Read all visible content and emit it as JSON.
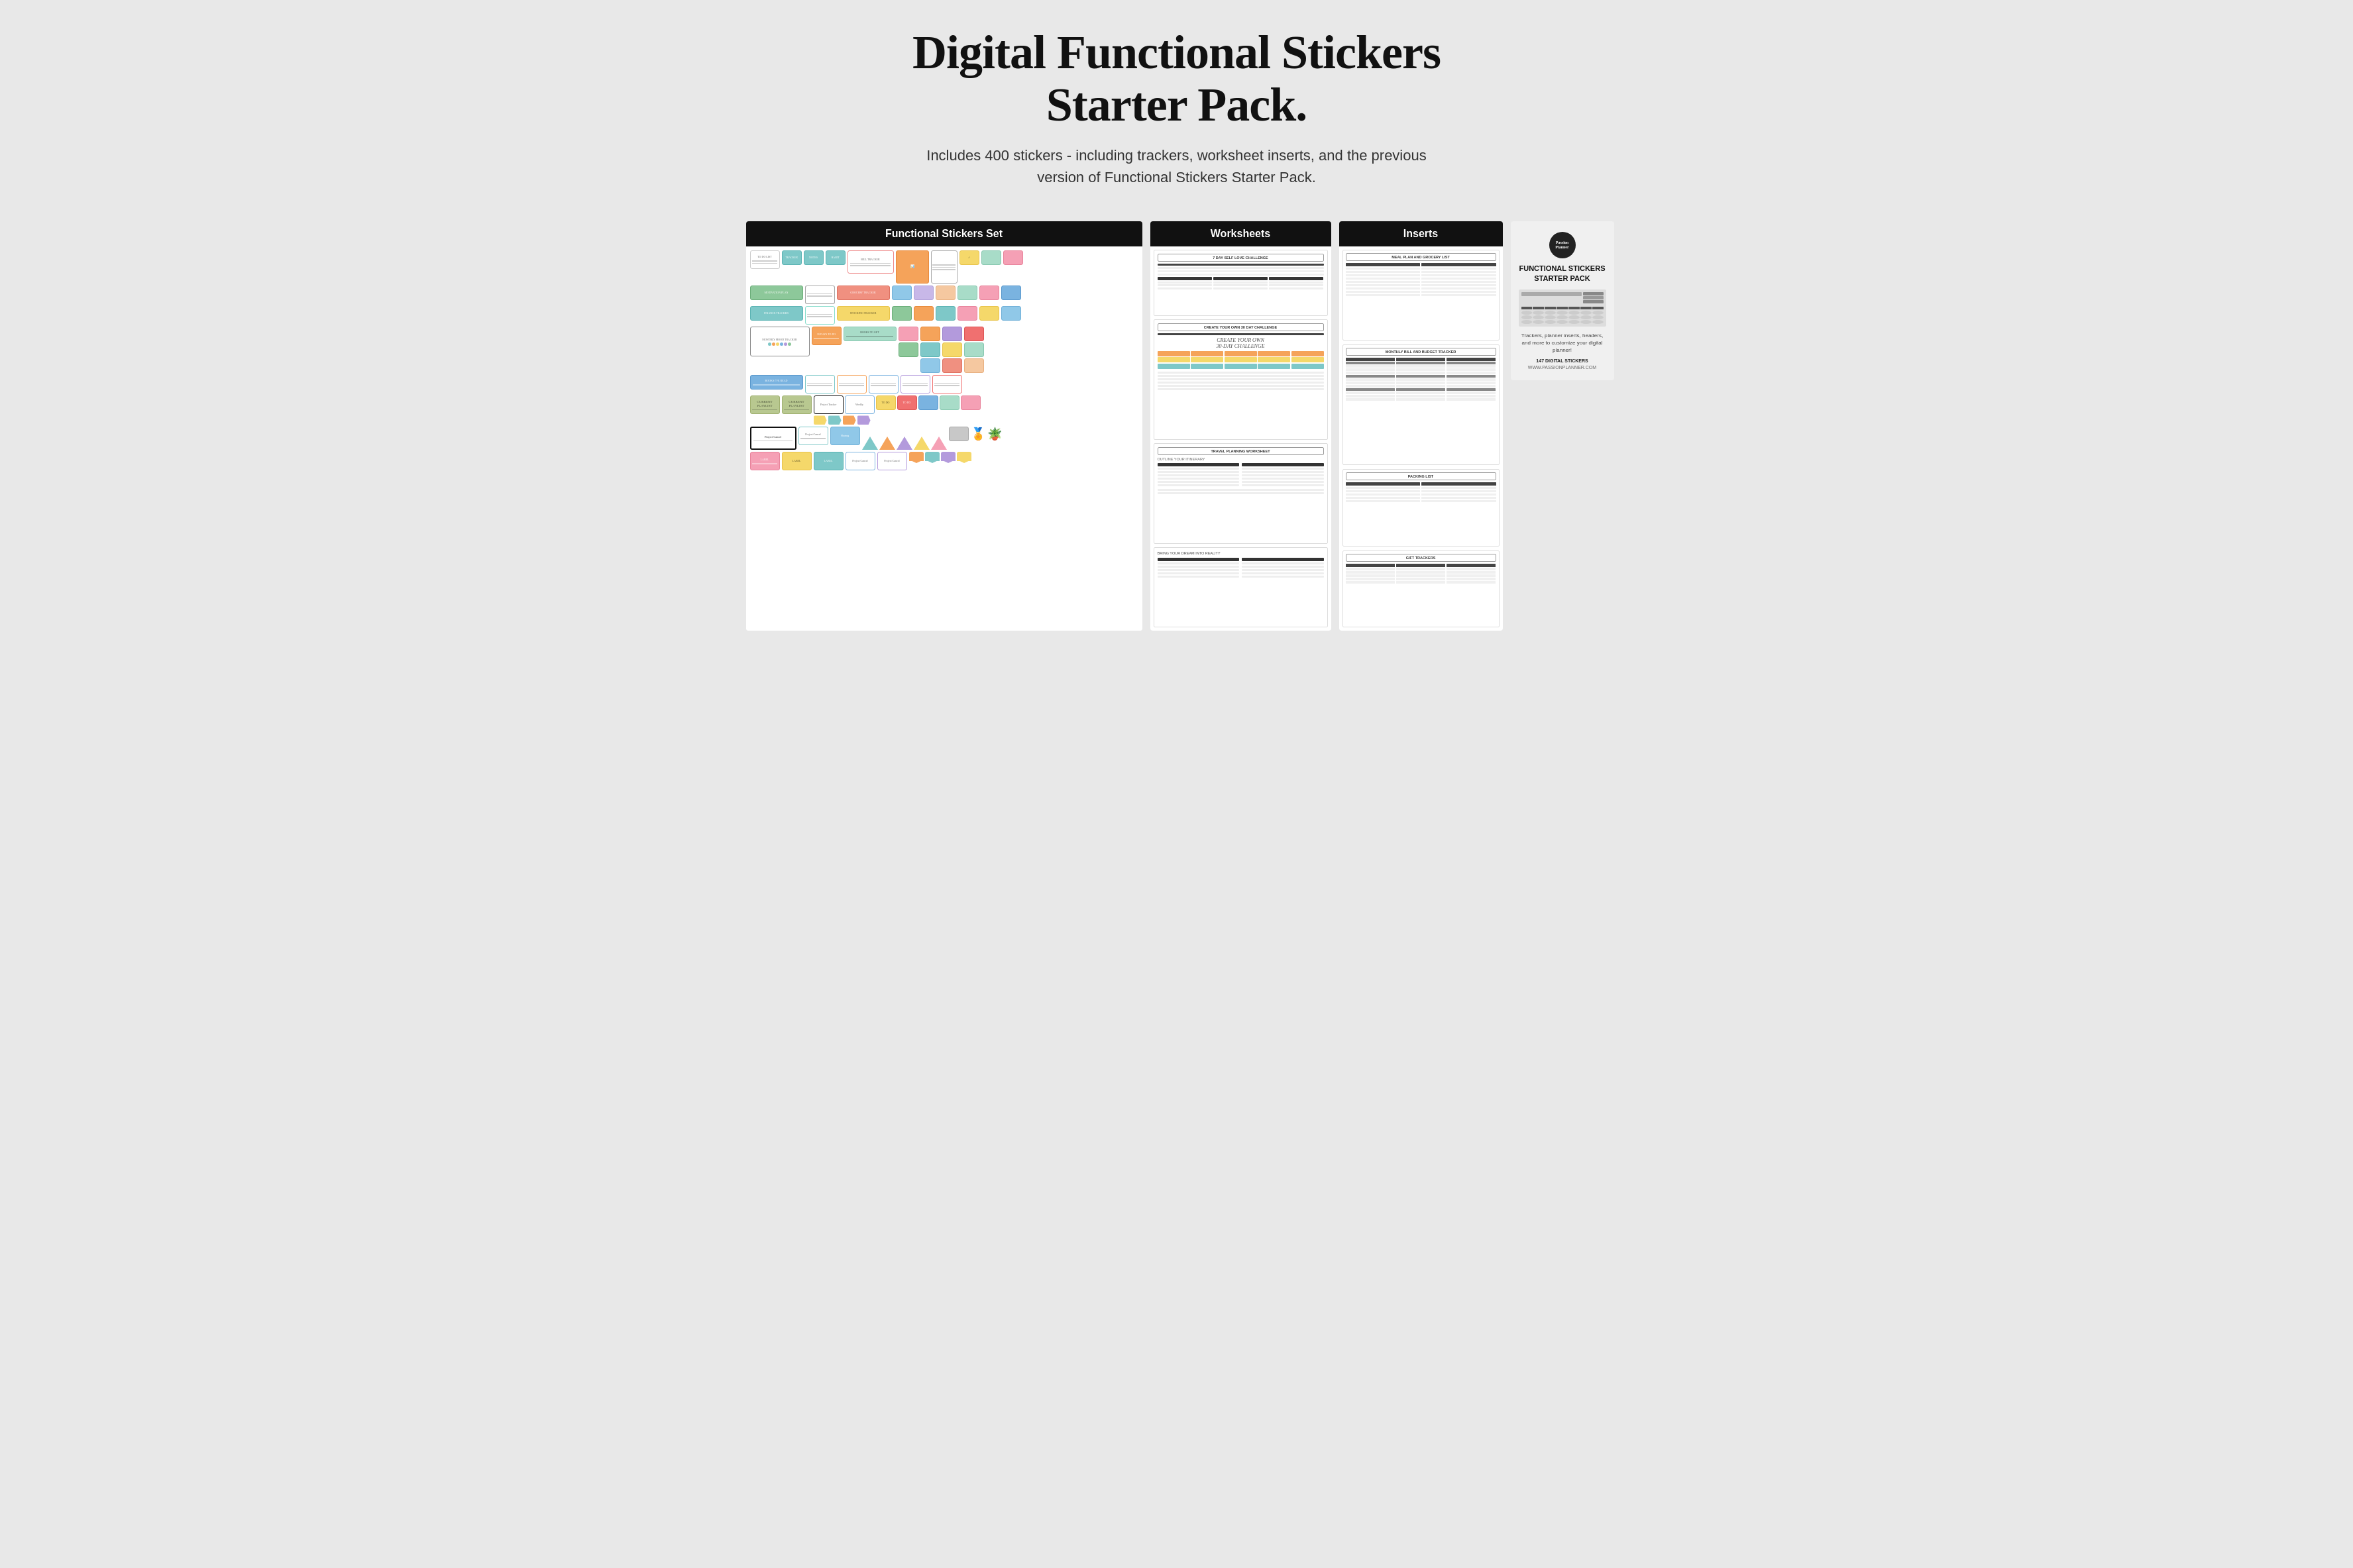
{
  "page": {
    "background_color": "#e8e8e8"
  },
  "header": {
    "title_line1": "Digital Functional Stickers",
    "title_line2": "Starter Pack.",
    "subtitle": "Includes 400 stickers - including trackers, worksheet inserts, and the previous version of Functional Stickers Starter Pack."
  },
  "panels": {
    "stickers": {
      "header": "Functional Stickers Set"
    },
    "worksheets": {
      "header": "Worksheets",
      "items": [
        "7 DAY SELF LOVE CHALLENGE",
        "CREATE YOUR OWN 30 DAY CHALLENGE",
        "TRAVEL PLANNING WORKSHEET",
        "BRING YOUR DREAM INTO REALITY"
      ]
    },
    "inserts": {
      "header": "Inserts",
      "items": [
        "MEAL PLAN AND GROCERY LIST",
        "MONTHLY BILL AND BUDGET TRACKER",
        "PACKING LIST",
        "GIFT TRACKERS"
      ]
    },
    "cover": {
      "logo_text": "Passion\nPlanner",
      "title": "FUNCTIONAL STICKERS\nSTARTER PACK",
      "description": "Trackers, planner inserts, headers, and more\nto customize your digital planner!",
      "sticker_count": "147 DIGITAL STICKERS",
      "url": "WWW.PASSIONPLANNER.COM"
    }
  }
}
